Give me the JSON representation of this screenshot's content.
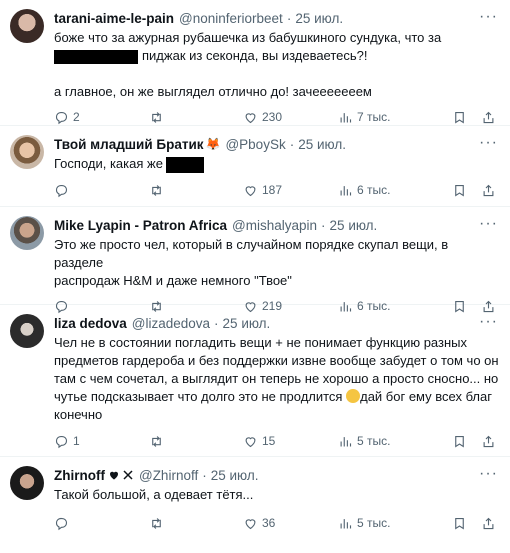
{
  "tweets": [
    {
      "name": "tarani-aime-le-pain",
      "handle": "@noninferiorbeet",
      "time": "25 июл.",
      "lines": [
        "боже что за ажурная рубашечка из бабушкиного сундука, что за",
        "пиджак из секонда, вы издеваетесь?!",
        "а главное, он же выглядел отлично до! зачееееееем"
      ],
      "replies": "2",
      "retweets": "",
      "likes": "230",
      "views": "7 тыс."
    },
    {
      "name": "Твой младший Братик",
      "badge": "🦊",
      "handle": "@PboySk",
      "time": "25 июл.",
      "lines": [
        "Господи, какая же"
      ],
      "replies": "",
      "retweets": "",
      "likes": "187",
      "views": "6 тыс."
    },
    {
      "name": "Mike Lyapin - Patron Africa",
      "handle": "@mishalyapin",
      "time": "25 июл.",
      "lines": [
        "Это же просто чел, который в случайном порядке скупал вещи, в разделе",
        "распродаж H&M и даже немного \"Твое\""
      ],
      "replies": "",
      "retweets": "",
      "likes": "219",
      "views": "6 тыс."
    },
    {
      "name": "liza dedova",
      "handle": "@lizadedova",
      "time": "25 июл.",
      "lines": [
        "Чел не в состоянии погладить вещи + не понимает функцию разных",
        "предметов гардероба и без поддержки извне вообще забудет о том чо он",
        "там с чем сочетал, а выглядит он теперь не хорошо а просто сносно... но",
        "чутье подсказывает что долго это не продлится",
        "дай бог ему всех благ",
        "конечно"
      ],
      "replies": "1",
      "retweets": "",
      "likes": "15",
      "views": "5 тыс."
    },
    {
      "name": "Zhirnoff",
      "handle": "@Zhirnoff",
      "time": "25 июл.",
      "lines": [
        "Такой большой, а одевает тётя..."
      ],
      "replies": "",
      "retweets": "",
      "likes": "36",
      "views": "5 тыс."
    }
  ],
  "ui": {
    "more": "···",
    "dot": "·"
  }
}
